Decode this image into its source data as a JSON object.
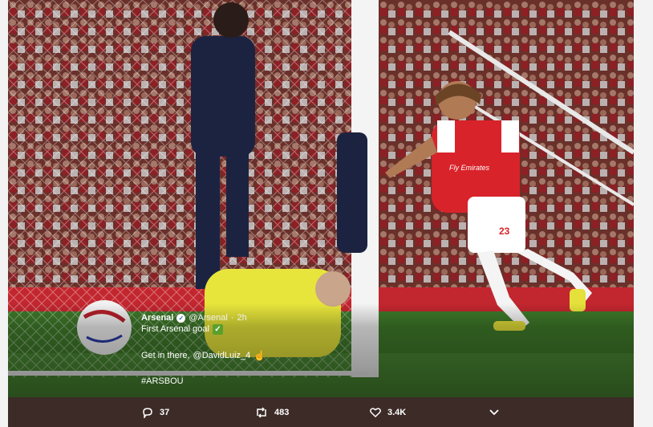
{
  "tweet": {
    "display_name": "Arsenal",
    "handle": "@Arsenal",
    "separator": "·",
    "time": "2h",
    "line1": "First Arsenal goal",
    "line2_prefix": "Get in there,",
    "mention": "@DavidLuiz_4",
    "hashtag": "#ARSBOU"
  },
  "photo_text": {
    "shirt_sponsor": "Fly Emirates",
    "shirt_number": "23"
  },
  "actions": {
    "replies": "37",
    "retweets": "483",
    "likes": "3.4K"
  },
  "icons": {
    "verified": "verified-badge-icon",
    "check": "check-mark-icon",
    "hand": "pointing-hand-icon",
    "reply": "reply-icon",
    "retweet": "retweet-icon",
    "like": "heart-icon",
    "more": "chevron-down-icon"
  },
  "colors": {
    "action_bar": "#3c2b27",
    "pitch": "#3f7a2a",
    "arsenal_red": "#d8232a",
    "keeper_yellow": "#e7e53b",
    "bournemouth_navy": "#1c2340"
  }
}
